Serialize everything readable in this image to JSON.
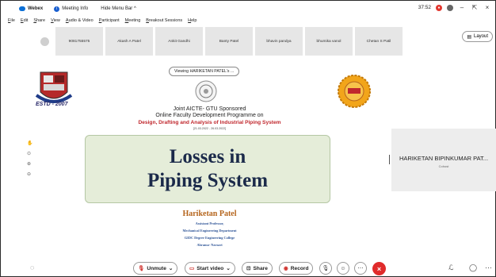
{
  "titlebar": {
    "app_name": "Webex",
    "meeting_info": "Meeting Info",
    "hide_menu": "Hide Menu Bar ^",
    "clock": "37:52",
    "minimize": "–",
    "pin": "⇱",
    "close": "×"
  },
  "menu": [
    "File",
    "Edit",
    "Share",
    "View",
    "Audio & Video",
    "Participant",
    "Meeting",
    "Breakout Sessions",
    "Help"
  ],
  "participants": [
    "9081755575",
    "Akash A Patel",
    "Ankit Gandhi",
    "Banty Patel",
    "bhavin pandya",
    "bhumika vanol",
    "Chetan S Patil"
  ],
  "layout_label": "Layout",
  "share_banner": "Viewing HARIKETAN PATEL's ...",
  "slide": {
    "estd": "ESTD - 2007",
    "line1": "Joint AICTE- GTU Sponsored",
    "line2": "Online Faculty Development Programme on",
    "line3": "Design, Drafting and Analysis of Industrial Piping System",
    "line4": "[21.03.2022 - 26.03.2022]",
    "title_line1": "Losses in",
    "title_line2": "Piping System",
    "presenter": "Hariketan Patel",
    "p1": "Assistant Professor,",
    "p2": "Mechanical Engineering Department",
    "p3": "GIDC Degree Engineering College",
    "p4": "Abrama- Navsari"
  },
  "speaker": {
    "name": "HARIKETAN BIPINKUMAR PAT...",
    "sub": "Cohost"
  },
  "controls": {
    "unmute": "Unmute",
    "start_video": "Start video",
    "share": "Share",
    "record": "Record"
  },
  "colors": {
    "accent_red": "#e02b2b",
    "slide_title": "#1b2a4a",
    "title_box": "#e5edd9",
    "program_red": "#c0272d"
  }
}
